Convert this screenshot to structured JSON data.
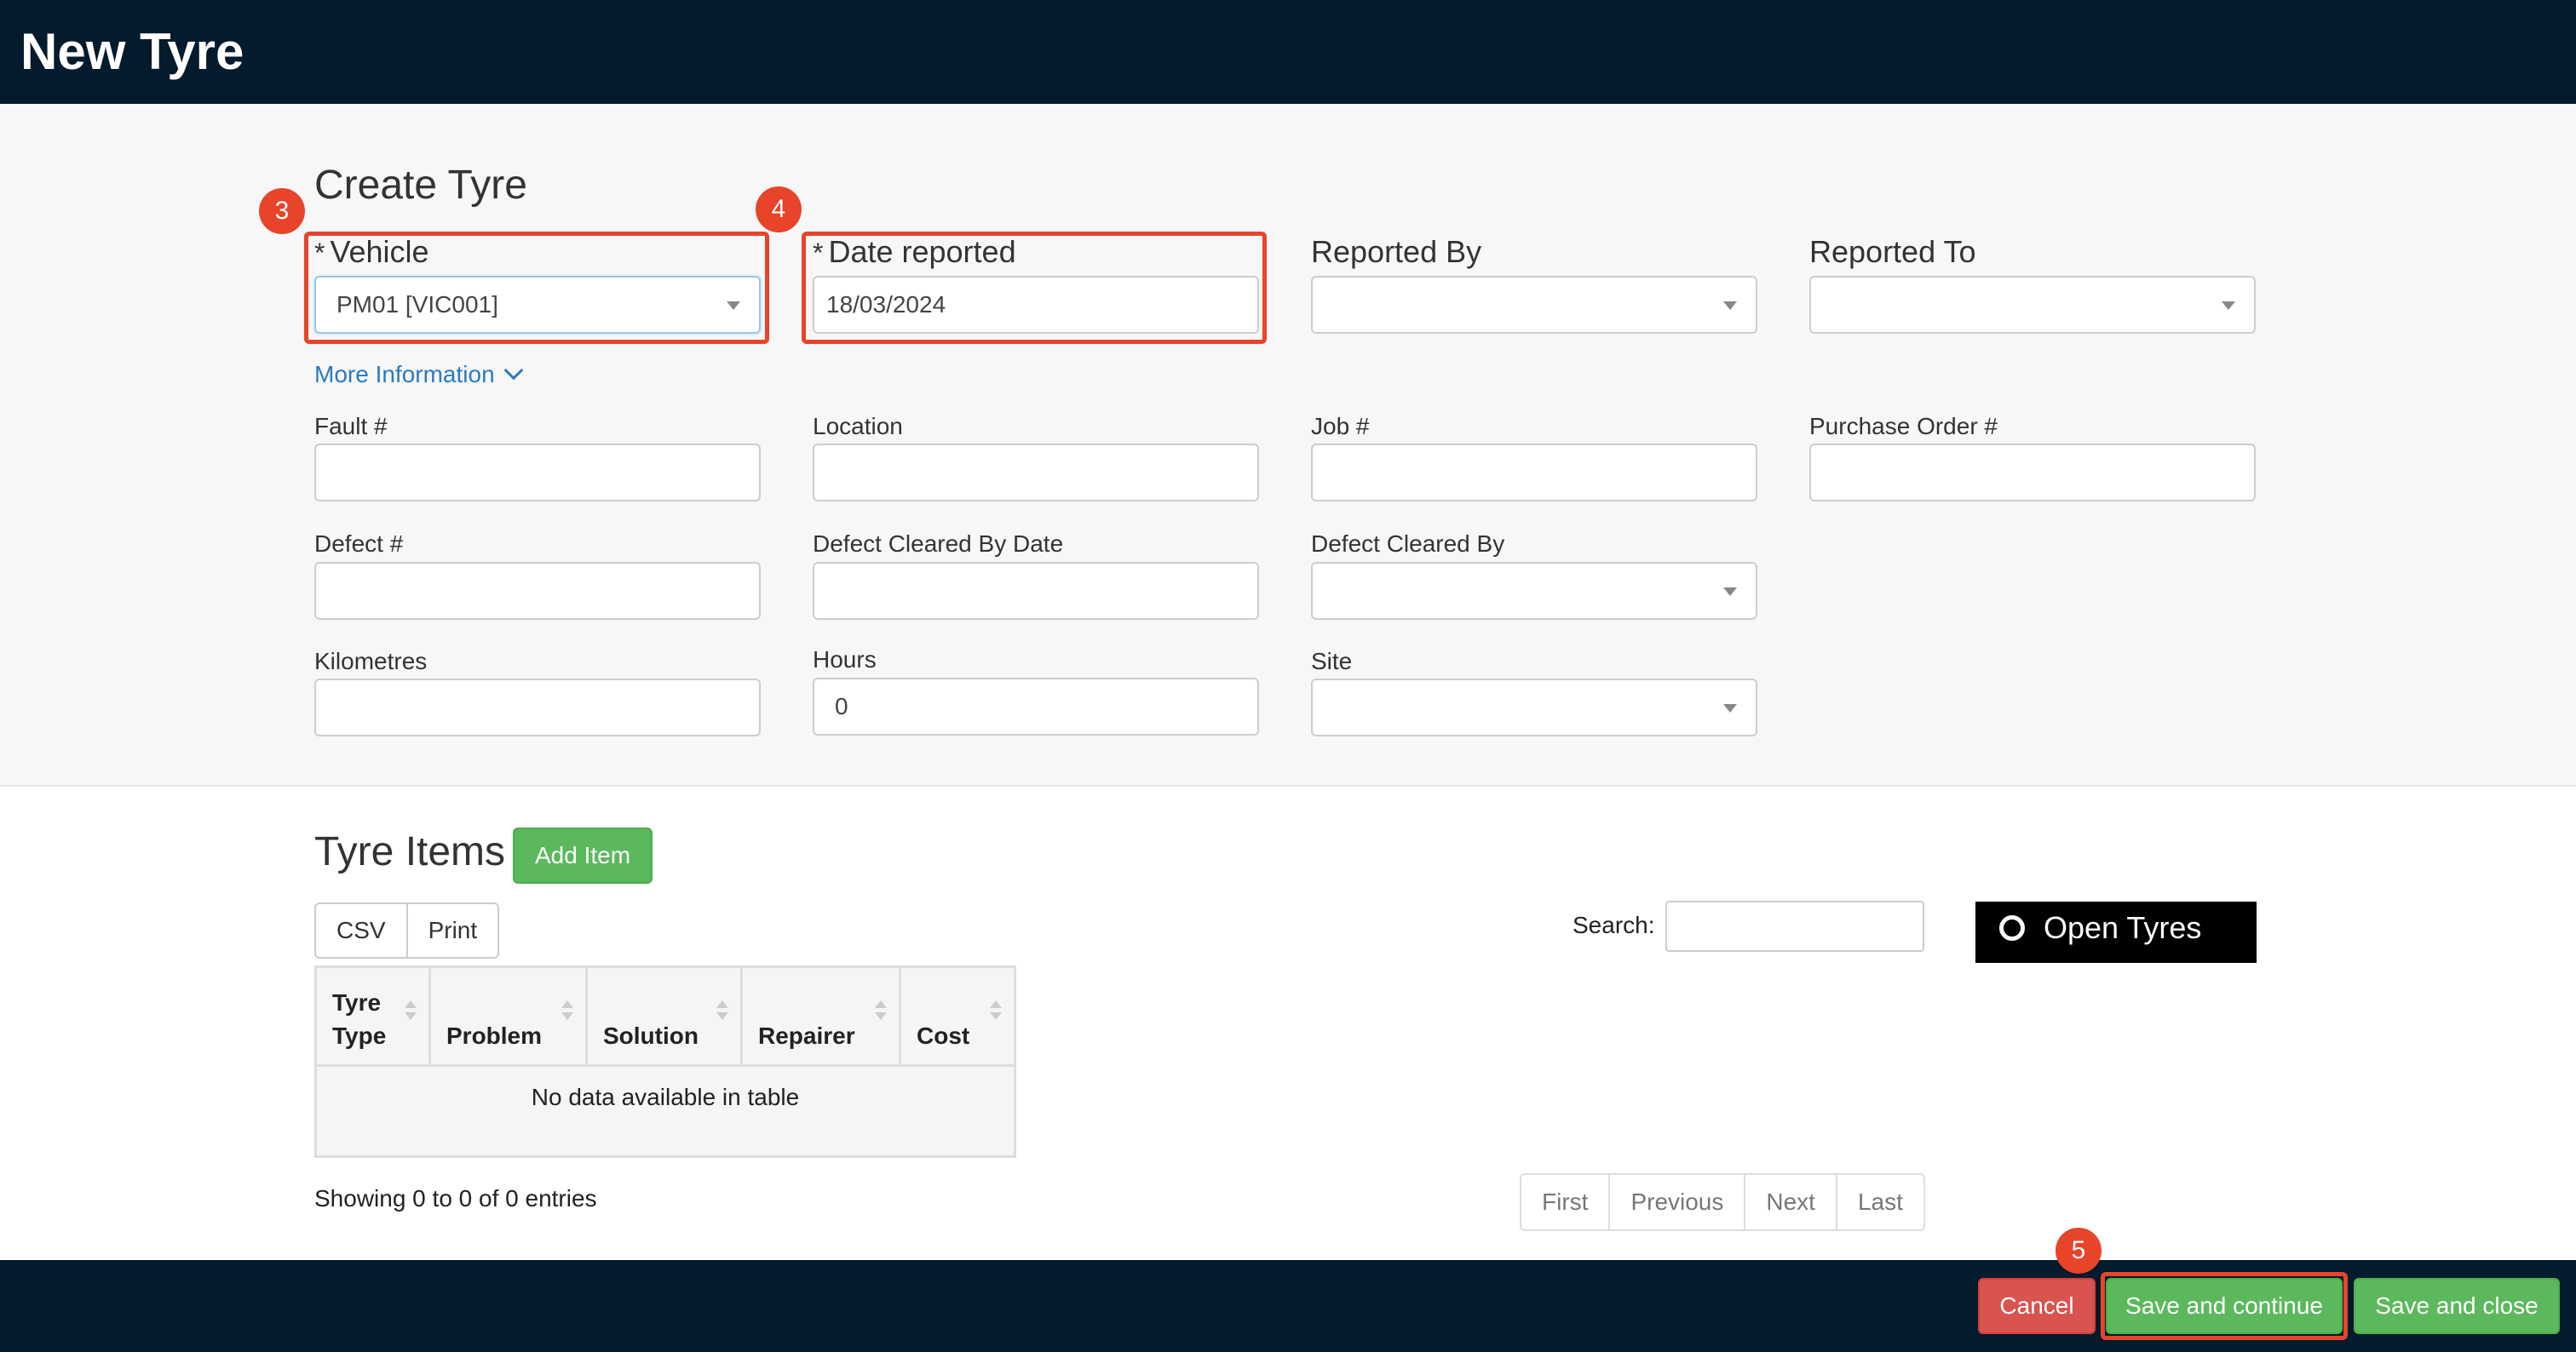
{
  "header": {
    "title": "New Tyre"
  },
  "form": {
    "section_title": "Create Tyre",
    "vehicle": {
      "label": "Vehicle",
      "required_mark": "*",
      "value": "PM01 [VIC001]"
    },
    "date_reported": {
      "label": "Date reported",
      "required_mark": "*",
      "value": "18/03/2024"
    },
    "reported_by": {
      "label": "Reported By",
      "value": ""
    },
    "reported_to": {
      "label": "Reported To",
      "value": ""
    },
    "more_information": "More Information",
    "fault": {
      "label": "Fault #",
      "value": ""
    },
    "location": {
      "label": "Location",
      "value": ""
    },
    "job": {
      "label": "Job #",
      "value": ""
    },
    "purchase_order": {
      "label": "Purchase Order #",
      "value": ""
    },
    "defect": {
      "label": "Defect #",
      "value": ""
    },
    "defect_cleared_by_date": {
      "label": "Defect Cleared By Date",
      "value": ""
    },
    "defect_cleared_by": {
      "label": "Defect Cleared By",
      "value": ""
    },
    "kilometres": {
      "label": "Kilometres",
      "value": ""
    },
    "hours": {
      "label": "Hours",
      "value": "0"
    },
    "site": {
      "label": "Site",
      "value": ""
    }
  },
  "annotations": {
    "badge_3": "3",
    "badge_4": "4",
    "badge_5": "5",
    "highlight_color": "#e8442a"
  },
  "items": {
    "title": "Tyre Items",
    "add_item": "Add Item",
    "export_buttons": [
      "CSV",
      "Print"
    ],
    "search_label": "Search:",
    "open_tyres": "Open Tyres",
    "columns": [
      "Tyre Type",
      "Problem",
      "Solution",
      "Repairer",
      "Cost"
    ],
    "empty_message": "No data available in table",
    "showing": "Showing 0 to 0 of 0 entries",
    "pager": [
      "First",
      "Previous",
      "Next",
      "Last"
    ]
  },
  "footer": {
    "cancel": "Cancel",
    "save_continue": "Save and continue",
    "save_close": "Save and close"
  },
  "colors": {
    "header_bg": "#041a2d",
    "green": "#5cb85c",
    "red": "#d9534f",
    "link": "#2a7ac0"
  }
}
